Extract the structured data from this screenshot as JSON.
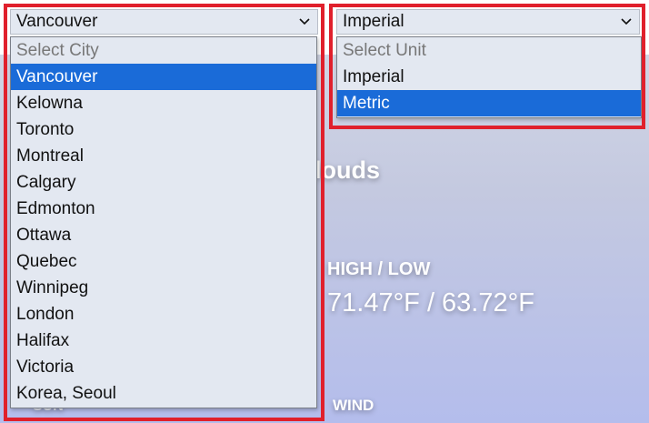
{
  "background": {
    "condition": "louds",
    "high_low_label": "HIGH / LOW",
    "high_low_value": "71.47°F / 63.72°F",
    "wind_label": "WIND",
    "sun_label": "SUN"
  },
  "city_select": {
    "value": "Vancouver",
    "options": [
      {
        "label": "Select City",
        "state": "placeholder"
      },
      {
        "label": "Vancouver",
        "state": "selected"
      },
      {
        "label": "Kelowna",
        "state": "normal"
      },
      {
        "label": "Toronto",
        "state": "normal"
      },
      {
        "label": "Montreal",
        "state": "normal"
      },
      {
        "label": "Calgary",
        "state": "normal"
      },
      {
        "label": "Edmonton",
        "state": "normal"
      },
      {
        "label": "Ottawa",
        "state": "normal"
      },
      {
        "label": "Quebec",
        "state": "normal"
      },
      {
        "label": "Winnipeg",
        "state": "normal"
      },
      {
        "label": "London",
        "state": "normal"
      },
      {
        "label": "Halifax",
        "state": "normal"
      },
      {
        "label": "Victoria",
        "state": "normal"
      },
      {
        "label": "Korea, Seoul",
        "state": "normal"
      }
    ]
  },
  "unit_select": {
    "value": "Imperial",
    "options": [
      {
        "label": "Select Unit",
        "state": "placeholder"
      },
      {
        "label": "Imperial",
        "state": "normal"
      },
      {
        "label": "Metric",
        "state": "selected"
      }
    ]
  },
  "colors": {
    "highlight_border": "#e0202c",
    "selected_option": "#1a6bd8"
  }
}
